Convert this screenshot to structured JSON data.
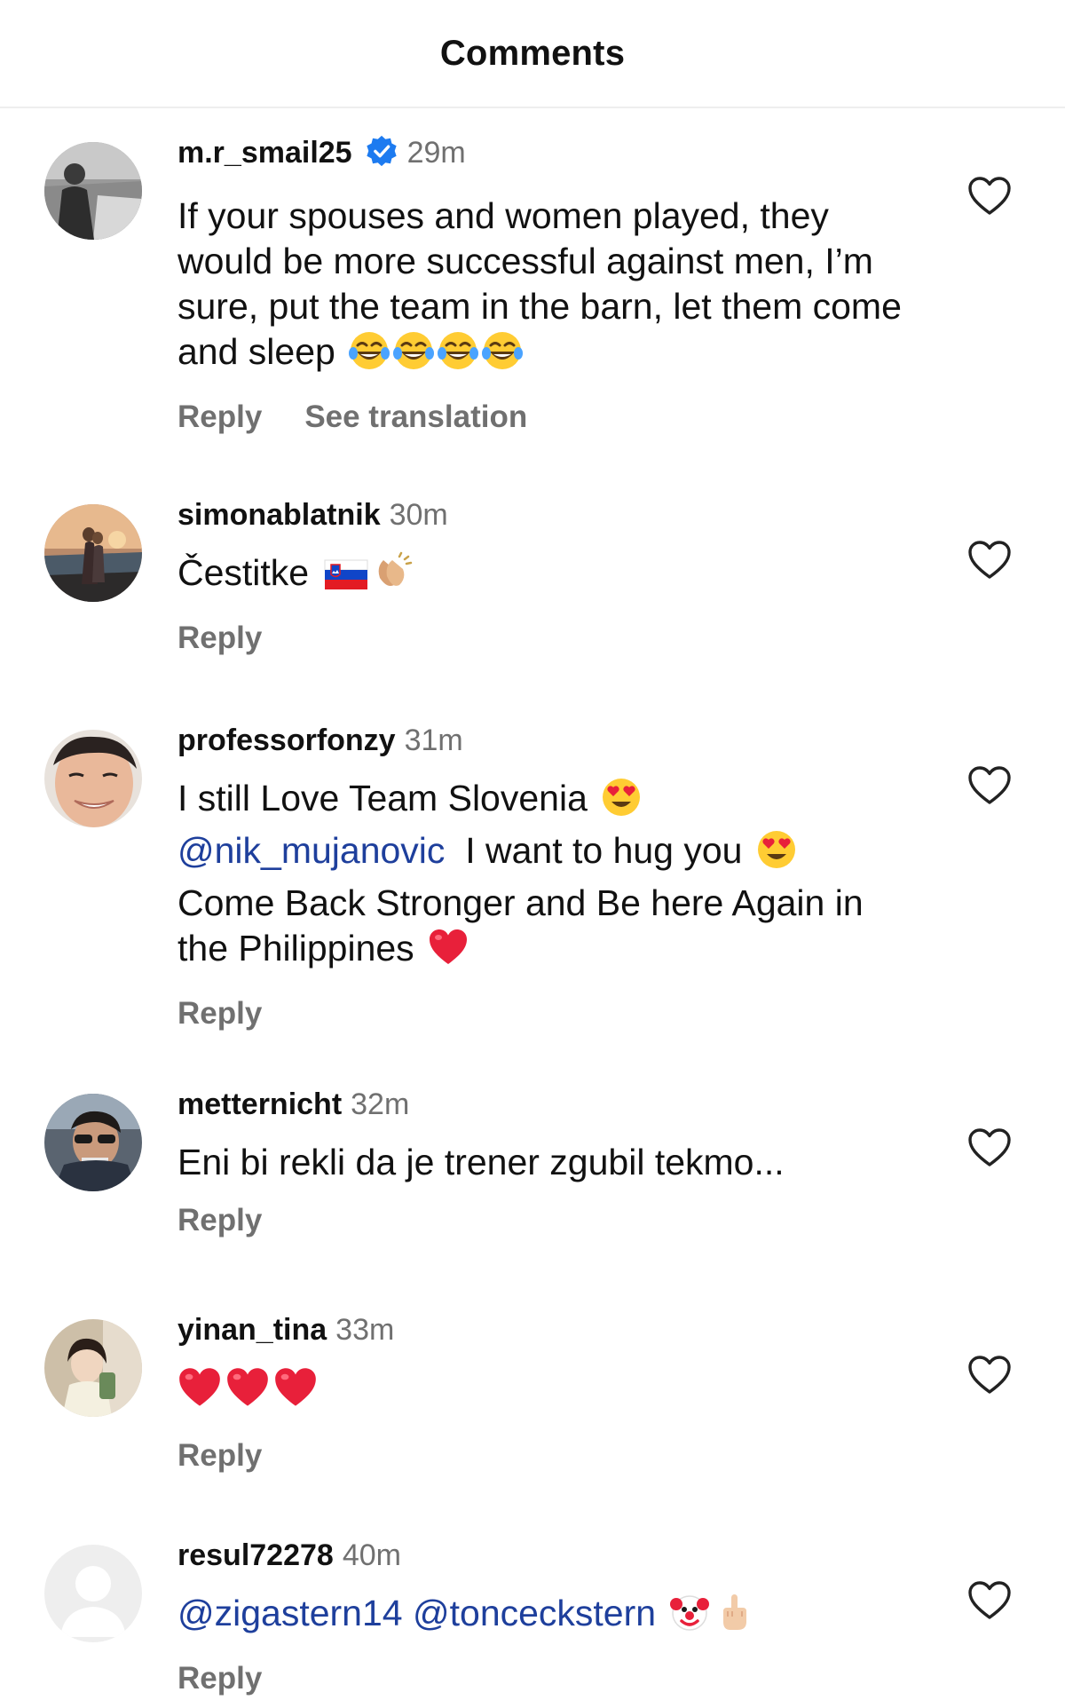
{
  "header": {
    "title": "Comments"
  },
  "comments": [
    {
      "username": "m.r_smail25",
      "verified": true,
      "time": "29m",
      "text": "If your spouses and women played, they would be more successful against men, I’m sure, put the team in the barn, let them come and sleep",
      "emoji": [
        "tears-of-joy",
        "tears-of-joy",
        "tears-of-joy",
        "tears-of-joy"
      ],
      "reply_label": "Reply",
      "translate_label": "See translation"
    },
    {
      "username": "simonablatnik",
      "time": "30m",
      "text": "Čestitke",
      "emoji": [
        "slovenia-flag",
        "clapping-hands"
      ],
      "reply_label": "Reply"
    },
    {
      "username": "professorfonzy",
      "time": "31m",
      "line1": "I still Love Team Slovenia",
      "mention": "@nik_mujanovic",
      "line2": "I want to hug you",
      "line3": "Come Back Stronger and Be here Again in the Philippines",
      "emoji": [
        "heart-eyes",
        "heart-eyes",
        "red-heart"
      ],
      "reply_label": "Reply"
    },
    {
      "username": "metternicht",
      "time": "32m",
      "text": "Eni bi rekli da je trener zgubil tekmo...",
      "reply_label": "Reply"
    },
    {
      "username": "yinan_tina",
      "time": "33m",
      "emoji": [
        "red-heart",
        "red-heart",
        "red-heart"
      ],
      "reply_label": "Reply"
    },
    {
      "username": "resul72278",
      "time": "40m",
      "mention1": "@zigastern14",
      "mention2": "@tonceckstern",
      "emoji": [
        "clown-face",
        "middle-finger"
      ],
      "reply_label": "Reply"
    }
  ],
  "colors": {
    "mention": "#1e3f9c",
    "verified": "#1d7bf0",
    "secondary_text": "#707070"
  }
}
